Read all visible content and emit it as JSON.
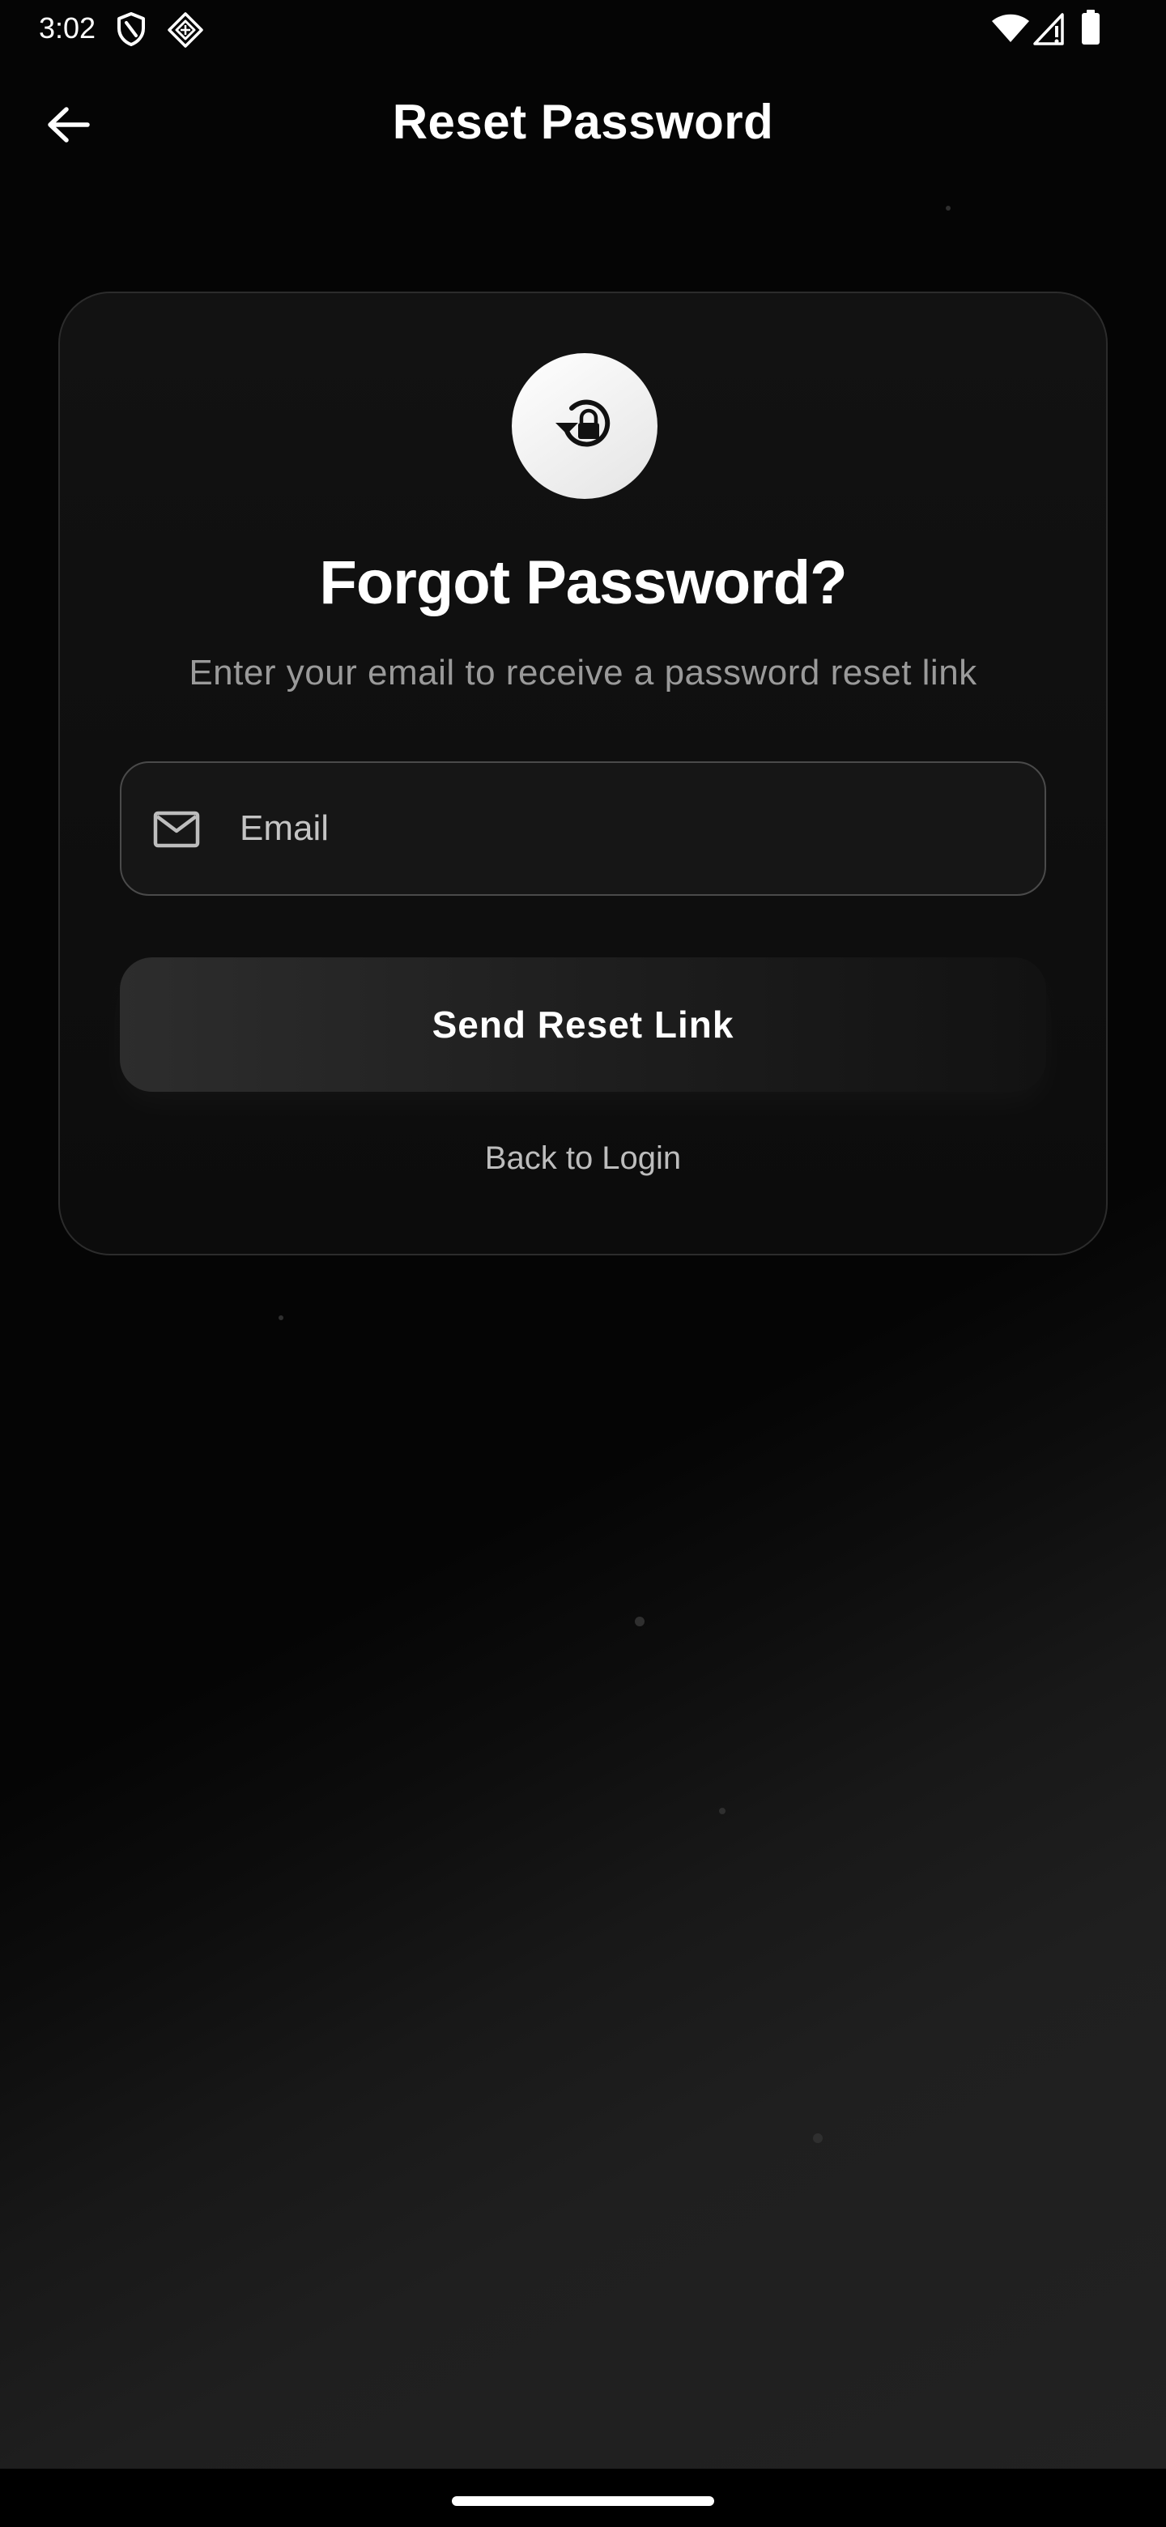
{
  "status_bar": {
    "time": "3:02",
    "icons": [
      "shield-icon",
      "app-notification-icon",
      "wifi-icon",
      "cellular-signal-icon",
      "battery-icon"
    ]
  },
  "app_bar": {
    "title": "Reset Password",
    "back_icon": "arrow-left-icon"
  },
  "card": {
    "icon": "lock-reset-icon",
    "title": "Forgot Password?",
    "subtitle": "Enter your email to receive a password reset link",
    "email_field": {
      "icon": "mail-icon",
      "placeholder": "Email",
      "value": ""
    },
    "send_button_label": "Send Reset Link",
    "back_to_login_label": "Back to Login"
  },
  "colors": {
    "background": "#050505",
    "card_background": "#121212",
    "card_border": "#2c2c2c",
    "field_border": "#4a4a4a",
    "subtitle_text": "#9a9a9a",
    "link_text": "#bdbdbd",
    "accent": "#ffffff"
  }
}
